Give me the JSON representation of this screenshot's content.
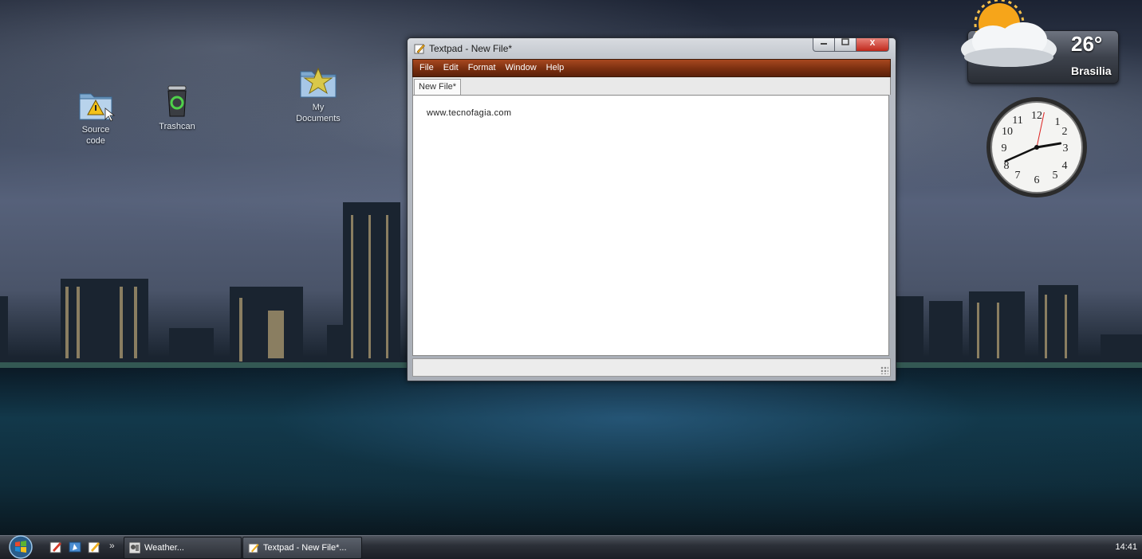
{
  "desktop": {
    "icons": [
      {
        "label": "Source\ncode",
        "icon": "folder-warning-icon"
      },
      {
        "label": "Trashcan",
        "icon": "recycle-bin-icon"
      },
      {
        "label": "My\nDocuments",
        "icon": "star-folder-icon"
      }
    ]
  },
  "window": {
    "title": "Textpad - New File*",
    "menu": [
      "File",
      "Edit",
      "Format",
      "Window",
      "Help"
    ],
    "tab_label": "New File*",
    "editor_text": "www.tecnofagia.com",
    "close_label": "X",
    "accent_color": "#7a2f10"
  },
  "widgets": {
    "weather": {
      "temperature": "26°",
      "city": "Brasilia"
    },
    "clock": {
      "hour": 2,
      "minute": 41,
      "second": 2
    }
  },
  "taskbar": {
    "quick_launch_more": "»",
    "tasks": [
      {
        "label": "Weather...",
        "icon": "weather-app-icon"
      },
      {
        "label": "Textpad - New File*...",
        "icon": "textpad-icon",
        "active": true
      }
    ],
    "time": "14:41"
  }
}
